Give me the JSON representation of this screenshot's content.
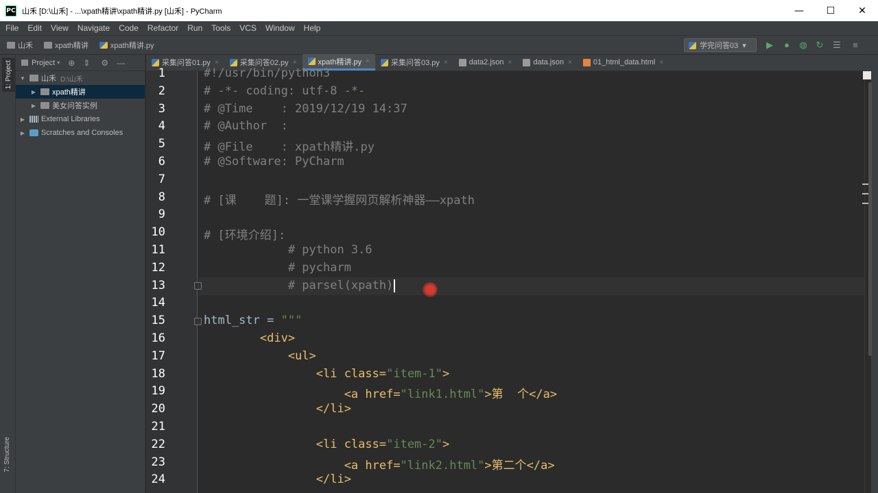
{
  "window": {
    "title": "山禾 [D:\\山禾] - ...\\xpath精讲\\xpath精讲.py [山禾] - PyCharm",
    "app_icon": "PC",
    "controls": [
      "—",
      "☐",
      "✕"
    ]
  },
  "menu": [
    "File",
    "Edit",
    "View",
    "Navigate",
    "Code",
    "Refactor",
    "Run",
    "Tools",
    "VCS",
    "Window",
    "Help"
  ],
  "breadcrumb": [
    "山禾",
    "xpath精讲",
    "xpath精讲.py"
  ],
  "run_config": {
    "label": "学完问答03",
    "arrow": "▾"
  },
  "toolbar_icons": [
    "run-icon",
    "debug-icon",
    "coverage-icon",
    "profile-icon",
    "build-icon",
    "stop-icon"
  ],
  "left_strip": {
    "project": "1: Project",
    "structure": "7: Structure"
  },
  "project_panel": {
    "header": "Project",
    "tree": [
      {
        "label": "山禾",
        "path": "D:\\山禾",
        "arrow": "▼"
      },
      {
        "label": "xpath精讲",
        "arrow": "▶"
      },
      {
        "label": "美女问答实例",
        "arrow": "▶"
      },
      {
        "label": "External Libraries",
        "arrow": "▶"
      },
      {
        "label": "Scratches and Consoles",
        "arrow": ""
      }
    ]
  },
  "tabs": [
    {
      "label": "采集问答01.py",
      "close": "×"
    },
    {
      "label": "采集问答02.py",
      "close": "×"
    },
    {
      "label": "xpath精讲.py",
      "close": "×"
    },
    {
      "label": "采集问答03.py",
      "close": "×"
    },
    {
      "label": "data2.json",
      "close": "×"
    },
    {
      "label": "data.json",
      "close": "×"
    },
    {
      "label": "01_html_data.html",
      "close": "×"
    }
  ],
  "editor": {
    "current_line": 13,
    "lines": [
      {
        "n": "1",
        "text": "#!/usr/bin/python3"
      },
      {
        "n": "2",
        "text": "# -*- coding: utf-8 -*-"
      },
      {
        "n": "3",
        "text": "# @Time    : 2019/12/19 14:37"
      },
      {
        "n": "4",
        "text": "# @Author  :"
      },
      {
        "n": "5",
        "text": "# @File    : xpath精讲.py"
      },
      {
        "n": "6",
        "text": "# @Software: PyCharm"
      },
      {
        "n": "7",
        "text": ""
      },
      {
        "n": "8",
        "text": "# [课    题]: 一堂课学握网页解析神器——xpath"
      },
      {
        "n": "9",
        "text": ""
      },
      {
        "n": "10",
        "text": "# [环境介绍]:"
      },
      {
        "n": "11",
        "text": "            # python 3.6"
      },
      {
        "n": "12",
        "text": "            # pycharm"
      },
      {
        "n": "13",
        "text": "            # parsel(xpath)"
      },
      {
        "n": "14",
        "text": ""
      },
      {
        "n": "15",
        "text": "html_str = \"\"\""
      },
      {
        "n": "16",
        "text": "        <div>"
      },
      {
        "n": "17",
        "text": "            <ul>"
      },
      {
        "n": "18",
        "text": "                <li class=\"item-1\">"
      },
      {
        "n": "19",
        "text": "                    <a href=\"link1.html\">第  个</a>"
      },
      {
        "n": "20",
        "text": "                </li>"
      },
      {
        "n": "21",
        "text": ""
      },
      {
        "n": "22",
        "text": "                <li class=\"item-2\">"
      },
      {
        "n": "23",
        "text": "                    <a href=\"link2.html\">第二个</a>"
      },
      {
        "n": "24",
        "text": "                </li>"
      }
    ]
  },
  "colors": {
    "background": "#2b2b2b",
    "comment": "#808080",
    "string": "#6a8759",
    "tag": "#e8bf6a",
    "selection": "#0d293e",
    "accent": "#4a88c7"
  }
}
